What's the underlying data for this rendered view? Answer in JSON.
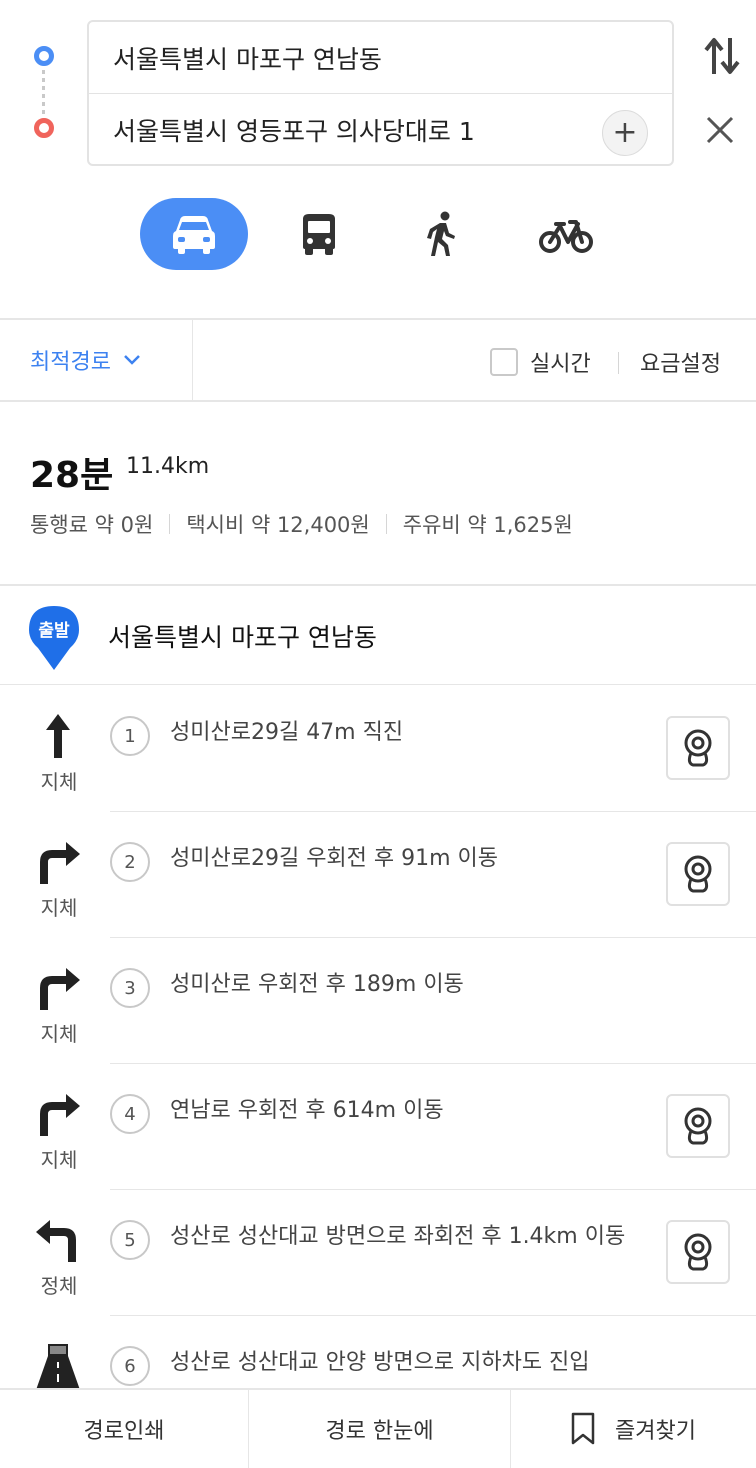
{
  "search": {
    "origin": "서울특별시 마포구 연남동",
    "destination": "서울특별시 영등포구 의사당대로 1",
    "add_label": "+"
  },
  "modes": [
    {
      "icon": "car-icon",
      "active": true
    },
    {
      "icon": "bus-icon",
      "active": false
    },
    {
      "icon": "walk-icon",
      "active": false
    },
    {
      "icon": "bike-icon",
      "active": false
    }
  ],
  "options": {
    "route_type": "최적경로",
    "realtime_label": "실시간",
    "fare_label": "요금설정"
  },
  "summary": {
    "time": "28분",
    "distance": "11.4km",
    "toll": "통행료 약 0원",
    "taxi": "택시비 약 12,400원",
    "fuel": "주유비 약 1,625원"
  },
  "start": {
    "badge": "출발",
    "name": "서울특별시 마포구 연남동"
  },
  "steps": [
    {
      "num": "1",
      "text": "성미산로29길 47m 직진",
      "traffic": "지체",
      "direction": "straight",
      "cctv": true
    },
    {
      "num": "2",
      "text": "성미산로29길 우회전 후 91m 이동",
      "traffic": "지체",
      "direction": "right",
      "cctv": true
    },
    {
      "num": "3",
      "text": "성미산로 우회전 후 189m 이동",
      "traffic": "지체",
      "direction": "right",
      "cctv": false
    },
    {
      "num": "4",
      "text": "연남로 우회전 후 614m 이동",
      "traffic": "지체",
      "direction": "right",
      "cctv": true
    },
    {
      "num": "5",
      "text": "성산로 성산대교 방면으로 좌회전 후 1.4km 이동",
      "traffic": "정체",
      "direction": "left",
      "cctv": true
    },
    {
      "num": "6",
      "text": "성산로 성산대교 안양 방면으로 지하차도 진입",
      "traffic": "",
      "direction": "tunnel",
      "cctv": false
    }
  ],
  "bottom": {
    "print": "경로인쇄",
    "overview": "경로 한눈에",
    "favorite": "즐겨찾기"
  },
  "colors": {
    "accent": "#4b8ef5",
    "origin_dot": "#4b8ef5",
    "destination_dot": "#f0645c",
    "link": "#3d82f0"
  }
}
